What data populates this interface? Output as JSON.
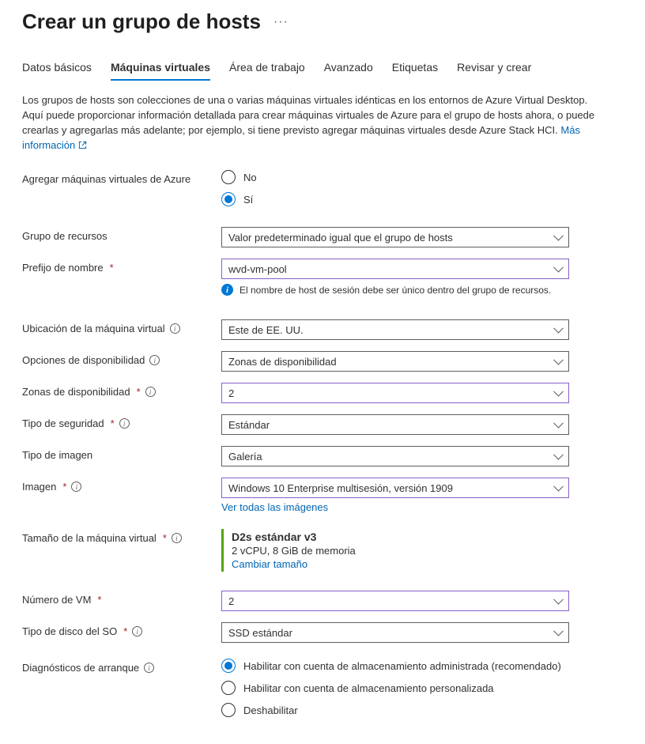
{
  "header": {
    "title": "Crear un grupo de hosts"
  },
  "tabs": [
    {
      "label": "Datos básicos"
    },
    {
      "label": "Máquinas virtuales"
    },
    {
      "label": "Área de trabajo"
    },
    {
      "label": "Avanzado"
    },
    {
      "label": "Etiquetas"
    },
    {
      "label": "Revisar y crear"
    }
  ],
  "description": {
    "text": "Los grupos de hosts son colecciones de una o varias máquinas virtuales idénticas en los entornos de Azure Virtual Desktop. Aquí puede proporcionar información detallada para crear máquinas virtuales de Azure para el grupo de hosts ahora, o puede crearlas y agregarlas más adelante; por ejemplo, si tiene previsto agregar máquinas virtuales desde Azure Stack HCI. ",
    "linkText": "Más información"
  },
  "addVms": {
    "label": "Agregar máquinas virtuales de Azure",
    "optionNo": "No",
    "optionYes": "Sí"
  },
  "resourceGroup": {
    "label": "Grupo de recursos",
    "value": "Valor predeterminado igual que el grupo de hosts"
  },
  "namePrefix": {
    "label": "Prefijo de nombre",
    "value": "wvd-vm-pool",
    "note": "El nombre de host de sesión debe ser único dentro del grupo de recursos."
  },
  "vmLocation": {
    "label": "Ubicación de la máquina virtual",
    "value": "Este de EE. UU."
  },
  "availabilityOptions": {
    "label": "Opciones de disponibilidad",
    "value": "Zonas de disponibilidad"
  },
  "availabilityZones": {
    "label": "Zonas de disponibilidad",
    "value": "2"
  },
  "securityType": {
    "label": "Tipo de seguridad",
    "value": "Estándar"
  },
  "imageType": {
    "label": "Tipo de imagen",
    "value": "Galería"
  },
  "image": {
    "label": "Imagen",
    "value": "Windows 10 Enterprise multisesión, versión 1909",
    "seeAll": "Ver todas las imágenes"
  },
  "vmSize": {
    "label": "Tamaño de la máquina virtual",
    "title": "D2s estándar v3",
    "sub": "2 vCPU, 8 GiB de memoria",
    "changeLink": "Cambiar tamaño"
  },
  "vmCount": {
    "label": "Número de VM",
    "value": "2"
  },
  "osDisk": {
    "label": "Tipo de disco del SO",
    "value": "SSD estándar"
  },
  "bootDiag": {
    "label": "Diagnósticos de arranque",
    "opt1": "Habilitar con cuenta de almacenamiento administrada (recomendado)",
    "opt2": "Habilitar con cuenta de almacenamiento personalizada",
    "opt3": "Deshabilitar"
  }
}
